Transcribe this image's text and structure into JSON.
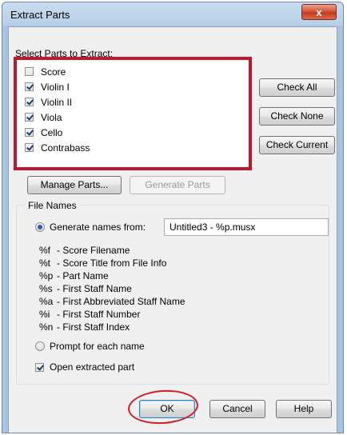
{
  "window": {
    "title": "Extract Parts",
    "close_label": "x"
  },
  "parts": {
    "heading": "Select Parts to Extract:",
    "items": [
      {
        "label": "Score",
        "checked": false
      },
      {
        "label": "Violin I",
        "checked": true
      },
      {
        "label": "Violin II",
        "checked": true
      },
      {
        "label": "Viola",
        "checked": true
      },
      {
        "label": "Cello",
        "checked": true
      },
      {
        "label": "Contrabass",
        "checked": true
      }
    ],
    "highlight_color": "#c0182a"
  },
  "side_buttons": {
    "check_all": "Check All",
    "check_none": "Check None",
    "check_current": "Check Current"
  },
  "actions": {
    "manage_parts": "Manage Parts...",
    "generate_parts": "Generate Parts"
  },
  "file_names": {
    "legend": "File Names",
    "generate_label": "Generate names from:",
    "generate_selected": true,
    "pattern_value": "Untitled3 - %p.musx",
    "codes": [
      {
        "code": "%f",
        "desc": "- Score Filename"
      },
      {
        "code": "%t",
        "desc": "- Score Title from File Info"
      },
      {
        "code": "%p",
        "desc": "- Part Name"
      },
      {
        "code": "%s",
        "desc": "- First Staff Name"
      },
      {
        "code": "%a",
        "desc": "- First Abbreviated Staff Name"
      },
      {
        "code": "%i",
        "desc": "- First Staff Number"
      },
      {
        "code": "%n",
        "desc": "- First Staff Index"
      }
    ],
    "prompt_label": "Prompt for each name",
    "prompt_selected": false,
    "open_extracted_label": "Open extracted part",
    "open_extracted_checked": true
  },
  "footer": {
    "ok": "OK",
    "cancel": "Cancel",
    "help": "Help",
    "ok_highlight_color": "#d21c2a"
  }
}
